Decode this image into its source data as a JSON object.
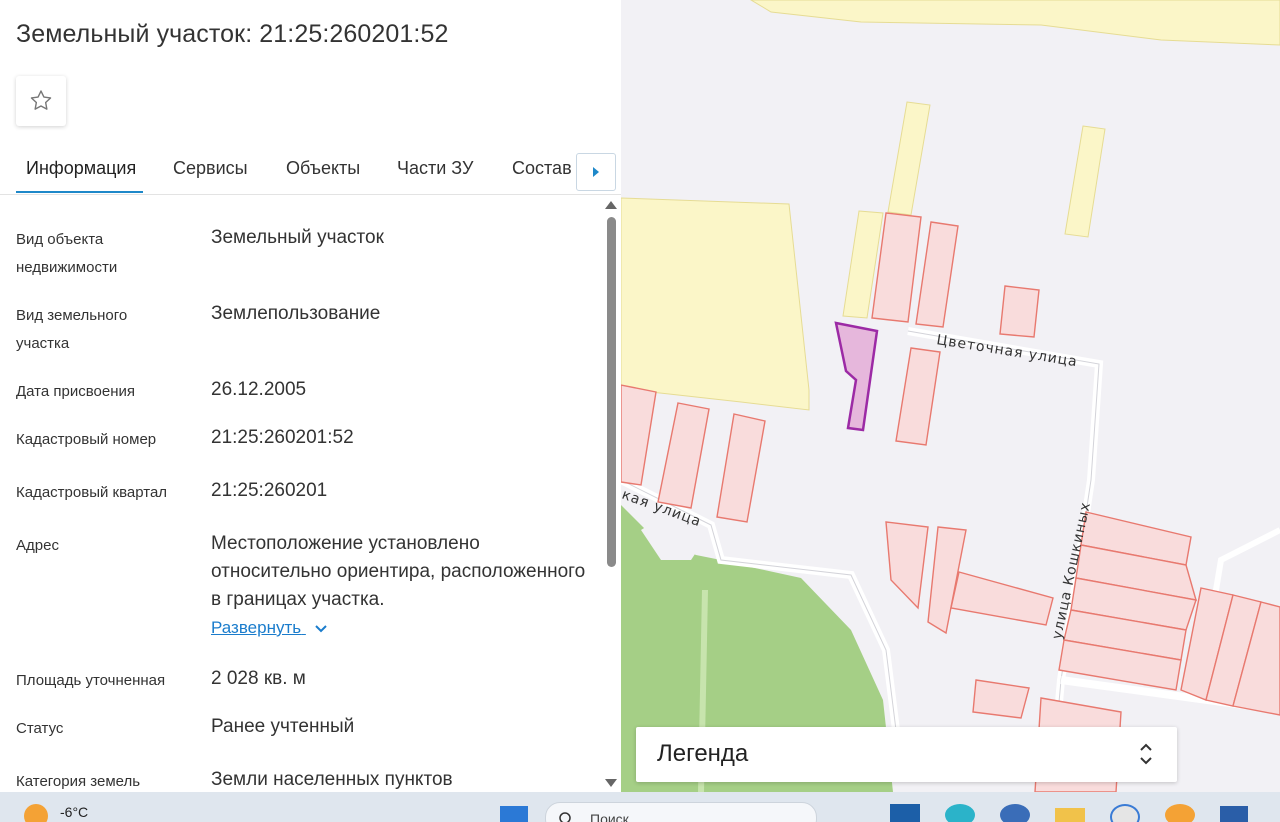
{
  "header": {
    "title": "Земельный участок: 21:25:260201:52"
  },
  "favorite": {
    "icon": "star-outline-icon"
  },
  "tabs": [
    {
      "label": "Информация",
      "active": true
    },
    {
      "label": "Сервисы"
    },
    {
      "label": "Объекты"
    },
    {
      "label": "Части ЗУ"
    },
    {
      "label": "Состав"
    }
  ],
  "tabs_next_icon": "caret-right-icon",
  "info": {
    "rows": [
      {
        "label": "Вид объекта недвижимости",
        "value": "Земельный участок"
      },
      {
        "label": "Вид земельного участка",
        "value": "Землепользование"
      },
      {
        "label": "Дата присвоения",
        "value": "26.12.2005"
      },
      {
        "label": "Кадастровый номер",
        "value": "21:25:260201:52"
      },
      {
        "label": "Кадастровый квартал",
        "value": "21:25:260201"
      },
      {
        "label": "Адрес",
        "value": "Местоположение установлено относительно ориентира, расположенного в границах участка."
      },
      {
        "label": "Площадь уточненная",
        "value": "2 028 кв. м"
      },
      {
        "label": "Статус",
        "value": "Ранее учтенный"
      },
      {
        "label": "Категория земель",
        "value": "Земли населенных пунктов"
      }
    ],
    "expand_label": "Развернуть"
  },
  "map": {
    "streets": [
      "Цветочная улица",
      "кая улица",
      "улица Кошкиных"
    ],
    "colors": {
      "background": "#f2f1f5",
      "yellow_zone": "#fbf6c8",
      "parcel_fill": "#f9dcdc",
      "parcel_stroke": "#e8796f",
      "selected_fill": "#e6b7dc",
      "selected_stroke": "#9c2aa5",
      "green": "#a5cf86"
    }
  },
  "legend": {
    "title": "Легенда",
    "icon": "chevron-up-down-icon"
  },
  "taskbar": {
    "weather": "-6°C",
    "search_placeholder": "Поиск"
  }
}
